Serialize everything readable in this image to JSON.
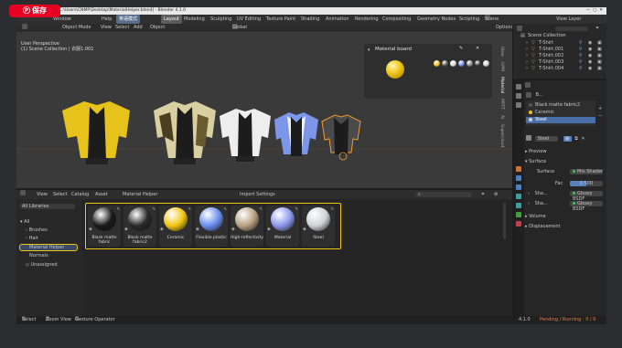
{
  "window": {
    "title": "* Material Helper \\ C:\\Users\\CNMP\\Desktop\\MaterialHelper.blend] - Blender 4.1.0"
  },
  "overlay": {
    "badge": "保存"
  },
  "menubar": {
    "items": [
      "File",
      "Edit",
      "Render",
      "Window",
      "Help"
    ],
    "lang_button": "英语模式",
    "workspaces": [
      "Layout",
      "Modeling",
      "Sculpting",
      "UV Editing",
      "Texture Paint",
      "Shading",
      "Animation",
      "Rendering",
      "Compositing",
      "Geometry Nodes",
      "Scripting"
    ],
    "active_workspace": "Layout",
    "scene": "Scene",
    "view_layer": "View Layer"
  },
  "viewport": {
    "header": {
      "mode": "Object Mode",
      "menus": [
        "View",
        "Select",
        "Add",
        "Object"
      ],
      "orientation": "Global",
      "options": "Options"
    },
    "info_line1": "User Perspective",
    "info_line2": "(1) Scene Collection | 衣服1.001",
    "side_tabs": [
      "View",
      "UPM",
      "Material",
      "MPTT",
      "AI",
      "Supercloud"
    ]
  },
  "material_board": {
    "title": "Material board",
    "swatch_colors": [
      "#f0c419",
      "#555555",
      "#d8d8d8",
      "#6c86e0",
      "#8a8a8a",
      "#3a3a3a",
      "#cfcfcf"
    ]
  },
  "outliner": {
    "header": "Scene Collection",
    "items": [
      "T-Shirt",
      "T-Shirt.001",
      "T-Shirt.002",
      "T-Shirt.003",
      "T-Shirt.004"
    ]
  },
  "properties": {
    "object": "B...",
    "material_slots": [
      "Black matte fabric2",
      "Ceramic",
      "Steel"
    ],
    "active_material": "Steel",
    "sections": {
      "preview": "Preview",
      "surface": "Surface",
      "volume": "Volume",
      "displacement": "Displacement"
    },
    "surface_label": "Surface",
    "surface_value": "Mix Shader",
    "fac_label": "Fac",
    "fac_value": "0.500",
    "shader_rows": [
      {
        "label": "Sha...",
        "value": "Glossy BSDF"
      },
      {
        "label": "Sha...",
        "value": "Glossy BSDF"
      }
    ]
  },
  "asset_browser": {
    "header": {
      "menus": [
        "View",
        "Select",
        "Catalog",
        "Asset"
      ],
      "library_name": "Material Helper",
      "import": "Import Settings"
    },
    "library_dropdown": "All Libraries",
    "tree": {
      "all": "All",
      "children": [
        "Brushes",
        "Hair",
        "Material Helper",
        "Normals"
      ],
      "unassigned": "Unassigned"
    },
    "selected_library": "Material Helper",
    "assets": [
      {
        "name": "Black matte fabric",
        "color": "#1a1a1a"
      },
      {
        "name": "Black matte fabric2",
        "color": "#2a2a2a"
      },
      {
        "name": "Ceramic",
        "color": "#f2c614"
      },
      {
        "name": "Flexible plastic",
        "color": "#6b8ff0"
      },
      {
        "name": "High-reflectivity",
        "color": "#b8a080"
      },
      {
        "name": "Material",
        "color": "#8e98ee"
      },
      {
        "name": "Steel",
        "color": "#cfd2d4"
      }
    ]
  },
  "statusbar": {
    "left": [
      "Select",
      "Zoom View",
      "Gesture Operator"
    ],
    "version": "4.1.0",
    "right": "Pending / Running : 0 / 0"
  },
  "colors": {
    "accent": "#f0c419",
    "active_tab": "#5680c2"
  }
}
